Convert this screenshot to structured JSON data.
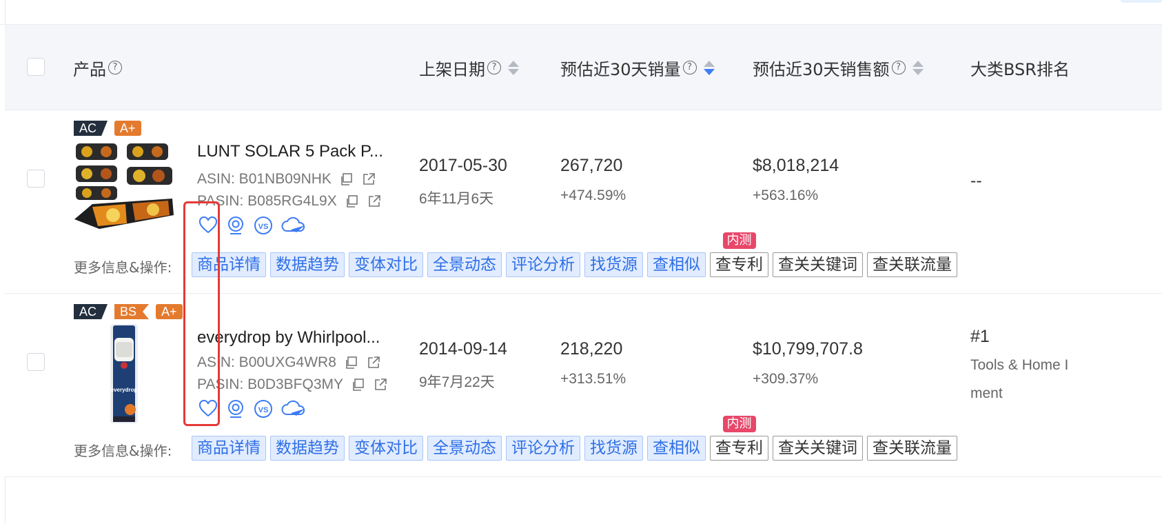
{
  "header": {
    "product": "产品",
    "help": "?",
    "listing_date": "上架日期",
    "est_30d_sales": "预估近30天销量",
    "est_30d_revenue": "预估近30天销售额",
    "category_bsr": "大类BSR排名"
  },
  "rows": [
    {
      "badges": [
        "AC",
        "A+"
      ],
      "title": "LUNT SOLAR 5 Pack P...",
      "asin": "ASIN: B01NB09NHK",
      "pasin": "PASIN: B085RG4L9X",
      "date": "2017-05-30",
      "age": "6年11月6天",
      "sales": "267,720",
      "sales_change": "+474.59%",
      "revenue": "$8,018,214",
      "revenue_change": "+563.16%",
      "bsr": "--",
      "bsr_category": ""
    },
    {
      "badges": [
        "AC",
        "BS",
        "A+"
      ],
      "title": "everydrop by Whirlpool...",
      "asin": "ASIN: B00UXG4WR8",
      "pasin": "PASIN: B0D3BFQ3MY",
      "date": "2014-09-14",
      "age": "9年7月22天",
      "sales": "218,220",
      "sales_change": "+313.51%",
      "revenue": "$10,799,707.8",
      "revenue_change": "+309.37%",
      "bsr": "#1",
      "bsr_category": "Tools & Home I",
      "bsr_category_2": "ment"
    }
  ],
  "ops": {
    "label": "更多信息&操作:",
    "product_detail": "商品详情",
    "data_trend": "数据趋势",
    "variant_compare": "变体对比",
    "panorama": "全景动态",
    "review_analysis": "评论分析",
    "find_source": "找货源",
    "find_similar": "查相似",
    "check_patent": "查专利",
    "beta": "内测",
    "related_keywords": "查关关键词",
    "related_traffic": "查关联流量"
  },
  "colors": {
    "accent": "#3d7cf4",
    "highlight": "#e53935",
    "beta_tag": "#e8476a",
    "badge_orange": "#e47a2e",
    "badge_dark": "#232f3e"
  }
}
